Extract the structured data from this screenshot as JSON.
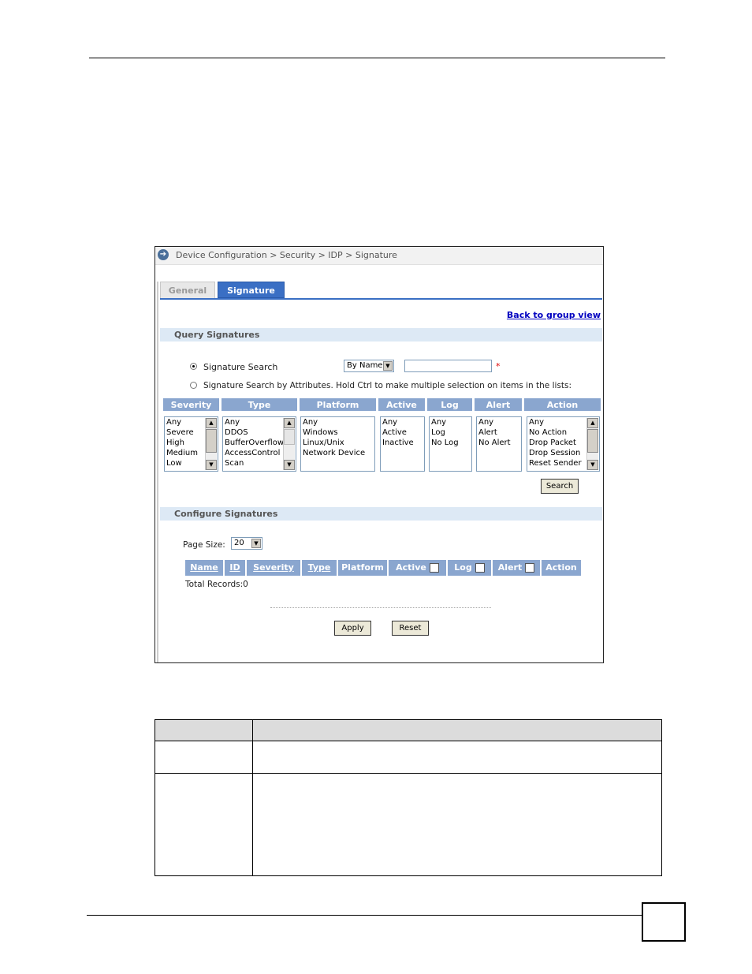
{
  "breadcrumb": "Device Configuration > Security > IDP > Signature",
  "tabs": {
    "general": "General",
    "signature": "Signature"
  },
  "back_link": "Back to group view",
  "query_section": "Query Signatures",
  "search": {
    "option_name": "Signature Search",
    "by_select": "By Name",
    "required_mark": "*",
    "option_attributes": "Signature Search by Attributes. Hold Ctrl to make multiple selection on items in the lists:"
  },
  "attr_headers": [
    "Severity",
    "Type",
    "Platform",
    "Active",
    "Log",
    "Alert",
    "Action"
  ],
  "attr_lists": {
    "severity": [
      "Any",
      "Severe",
      "High",
      "Medium",
      "Low"
    ],
    "type": [
      "Any",
      "DDOS",
      "BufferOverflow",
      "AccessControl",
      "Scan"
    ],
    "platform": [
      "Any",
      "Windows",
      "Linux/Unix",
      "Network Device"
    ],
    "active": [
      "Any",
      "Active",
      "Inactive"
    ],
    "log": [
      "Any",
      "Log",
      "No Log"
    ],
    "alert": [
      "Any",
      "Alert",
      "No Alert"
    ],
    "action": [
      "Any",
      "No Action",
      "Drop Packet",
      "Drop Session",
      "Reset Sender"
    ]
  },
  "search_button": "Search",
  "configure_section": "Configure Signatures",
  "page_size": {
    "label": "Page Size:",
    "value": "20"
  },
  "table_headers": [
    "Name",
    "ID",
    "Severity",
    "Type",
    "Platform",
    "Active",
    "Log",
    "Alert",
    "Action"
  ],
  "total_records": "Total Records:0",
  "apply_button": "Apply",
  "reset_button": "Reset"
}
